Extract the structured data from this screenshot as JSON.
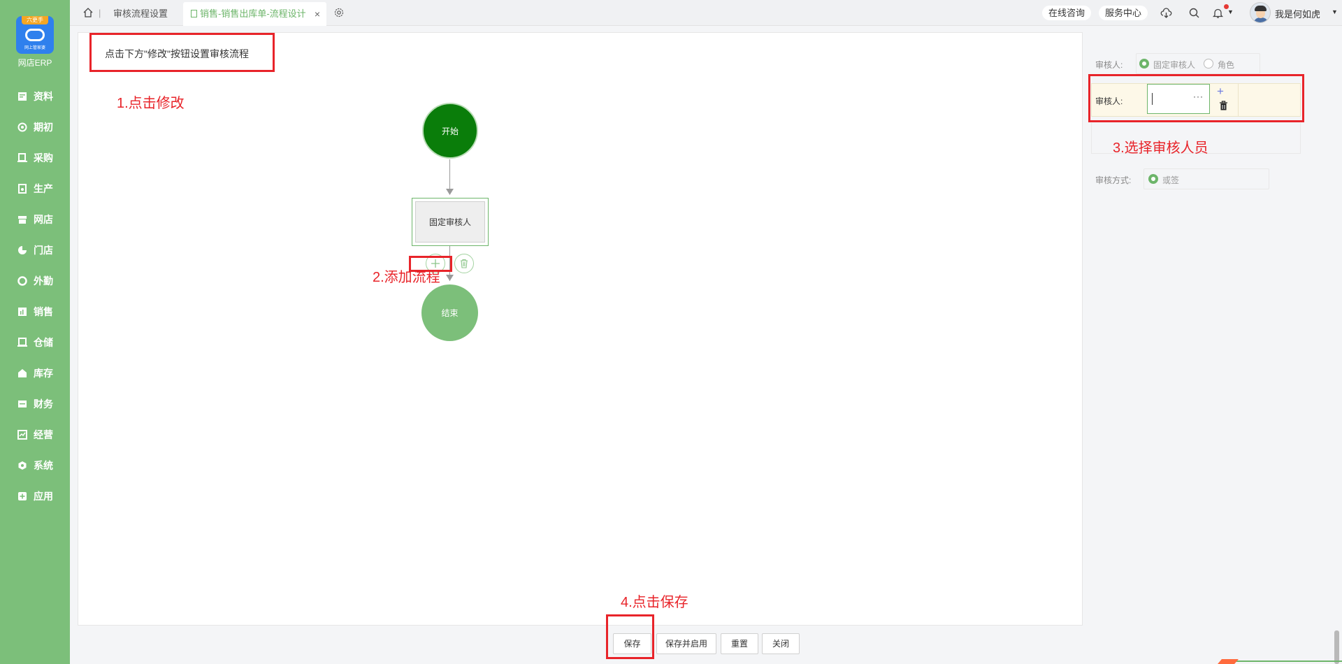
{
  "sidebar": {
    "logo_ribbon": "六更手",
    "logo_sub": "网上管家婆",
    "brand": "网店ERP",
    "items": [
      {
        "label": "资料",
        "icon": "document-icon"
      },
      {
        "label": "期初",
        "icon": "target-icon"
      },
      {
        "label": "采购",
        "icon": "cart-icon"
      },
      {
        "label": "生产",
        "icon": "production-icon"
      },
      {
        "label": "网店",
        "icon": "store-icon"
      },
      {
        "label": "门店",
        "icon": "pie-icon"
      },
      {
        "label": "外勤",
        "icon": "field-icon"
      },
      {
        "label": "销售",
        "icon": "sales-chart-icon"
      },
      {
        "label": "仓储",
        "icon": "warehouse-icon"
      },
      {
        "label": "库存",
        "icon": "inventory-icon"
      },
      {
        "label": "财务",
        "icon": "finance-icon"
      },
      {
        "label": "经营",
        "icon": "operations-icon"
      },
      {
        "label": "系统",
        "icon": "system-icon"
      },
      {
        "label": "应用",
        "icon": "apps-plus-icon"
      }
    ]
  },
  "topbar": {
    "tab1": "审核流程设置",
    "tab2": "销售-销售出库单-流程设计",
    "tab_close": "×",
    "online_consult": "在线咨询",
    "service_center": "服务中心",
    "username": "我是何如虎"
  },
  "canvas": {
    "hint": "点击下方\"修改\"按钮设置审核流程",
    "node_start": "开始",
    "node_fixed": "固定审核人",
    "node_end": "结束"
  },
  "annotations": {
    "step1": "1.点击修改",
    "step2": "2.添加流程",
    "step3": "3.选择审核人员",
    "step4": "4.点击保存"
  },
  "panel": {
    "approver_label": "审核人:",
    "radio_fixed": "固定审核人",
    "radio_role": "角色",
    "approver_row_label": "审核人:",
    "approver_value": "",
    "method_label": "审核方式:",
    "method_value": "或签"
  },
  "buttons": {
    "save": "保存",
    "save_enable": "保存并启用",
    "reset": "重置",
    "close": "关闭"
  },
  "colors": {
    "sidebar": "#7cbf7a",
    "accent": "#6db56a",
    "start_node": "#0a7d0a",
    "annotation": "#e8242a"
  }
}
